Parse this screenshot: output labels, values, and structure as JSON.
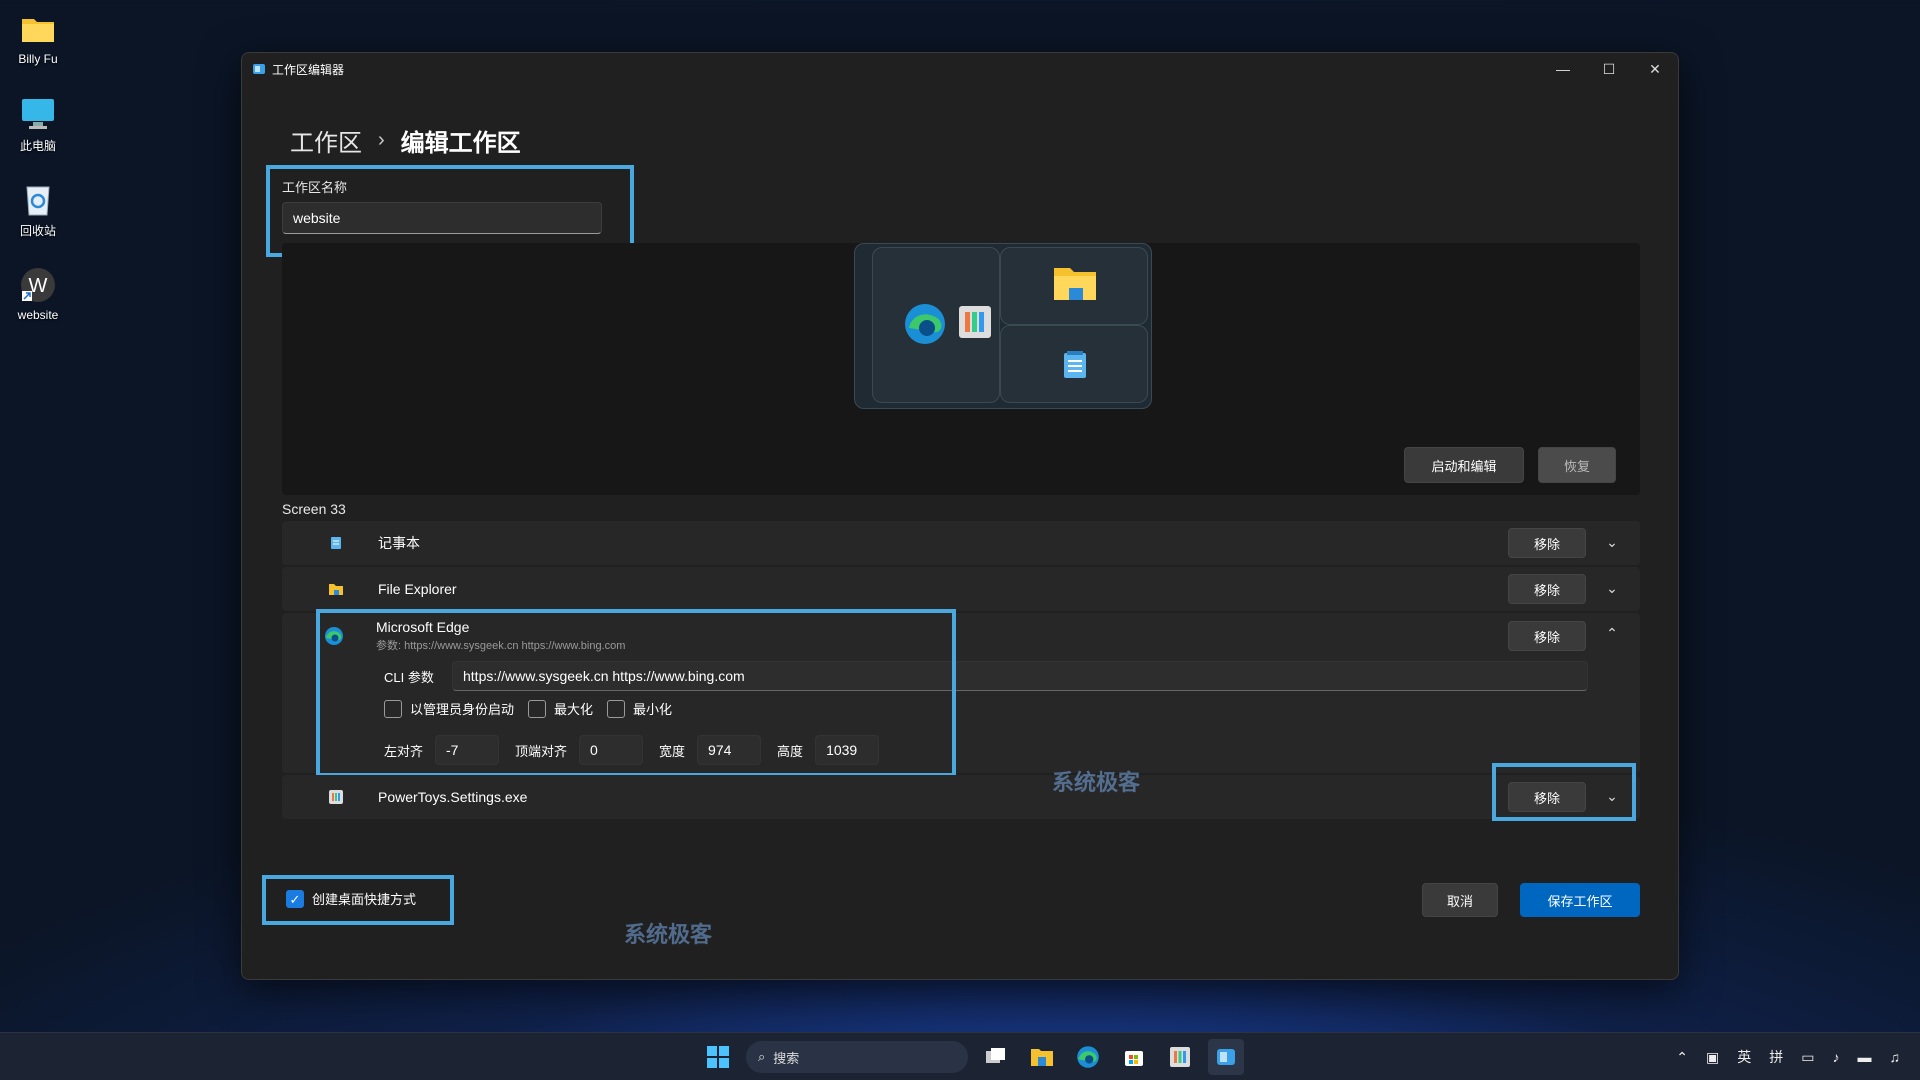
{
  "desktop": {
    "icons": [
      {
        "label": "Billy Fu",
        "icon": "folder-icon"
      },
      {
        "label": "此电脑",
        "icon": "computer-icon"
      },
      {
        "label": "回收站",
        "icon": "recycle-bin-icon"
      },
      {
        "label": "website",
        "icon": "workspace-shortcut-icon"
      }
    ]
  },
  "window": {
    "title": "工作区编辑器",
    "controls": {
      "minimize": "—",
      "maximize": "☐",
      "close": "✕"
    }
  },
  "breadcrumb": {
    "root": "工作区",
    "separator": "›",
    "current": "编辑工作区"
  },
  "workspace_name": {
    "label": "工作区名称",
    "value": "website"
  },
  "preview": {
    "launch_edit_label": "启动和编辑",
    "revert_label": "恢复"
  },
  "screen_label": "Screen 33",
  "apps": [
    {
      "name": "记事本",
      "remove_label": "移除",
      "icon": "notepad-icon",
      "expanded": false
    },
    {
      "name": "File Explorer",
      "remove_label": "移除",
      "icon": "file-explorer-icon",
      "expanded": false
    },
    {
      "name": "Microsoft Edge",
      "remove_label": "移除",
      "icon": "edge-icon",
      "expanded": true,
      "subtitle": "参数: https://www.sysgeek.cn https://www.bing.com",
      "cli_label": "CLI 参数",
      "cli_value": "https://www.sysgeek.cn https://www.bing.com",
      "checkboxes": {
        "admin": "以管理员身份启动",
        "maximize": "最大化",
        "minimize": "最小化"
      },
      "position": {
        "left_label": "左对齐",
        "left_value": "-7",
        "top_label": "顶端对齐",
        "top_value": "0",
        "width_label": "宽度",
        "width_value": "974",
        "height_label": "高度",
        "height_value": "1039"
      }
    },
    {
      "name": "PowerToys.Settings.exe",
      "remove_label": "移除",
      "icon": "powertoys-settings-icon",
      "expanded": false
    }
  ],
  "footer": {
    "shortcut_label": "创建桌面快捷方式",
    "shortcut_checked": true,
    "cancel_label": "取消",
    "save_label": "保存工作区"
  },
  "watermark": "系统极客",
  "taskbar": {
    "search_placeholder": "搜索",
    "tray": {
      "input_lang": "英",
      "ime": "拼"
    }
  },
  "colors": {
    "accent": "#0067c0",
    "highlight": "#4aa8e0",
    "window_bg": "#202020"
  }
}
